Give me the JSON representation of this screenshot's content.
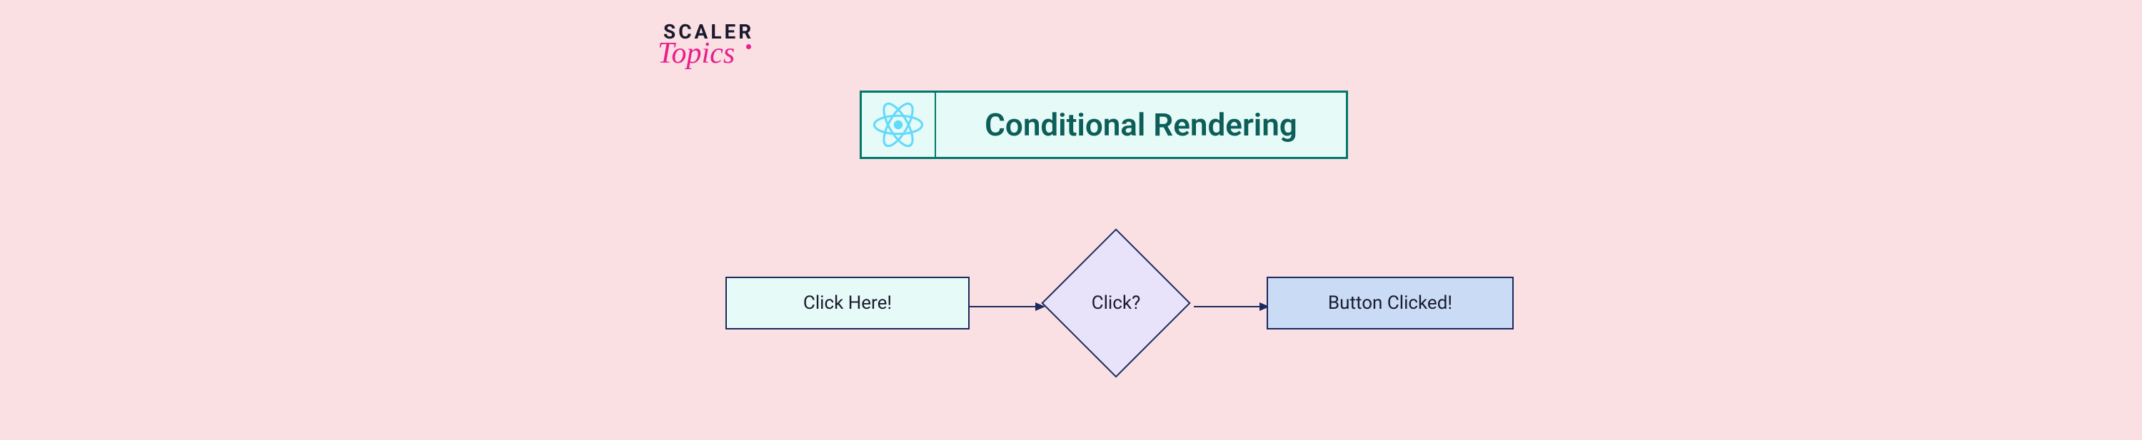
{
  "logo": {
    "line1": "SCALER",
    "line2": "Topics"
  },
  "title": "Conditional Rendering",
  "flow": {
    "start_box": "Click Here!",
    "decision": "Click?",
    "result_box": "Button Clicked!"
  },
  "colors": {
    "background": "#fadfe3",
    "teal_border": "#00796b",
    "teal_fill": "#e6faf7",
    "navy_border": "#1a2b5c",
    "blue_fill": "#c9dbf5",
    "lavender_fill": "#e8e3fa",
    "pink_accent": "#e91e8c"
  }
}
